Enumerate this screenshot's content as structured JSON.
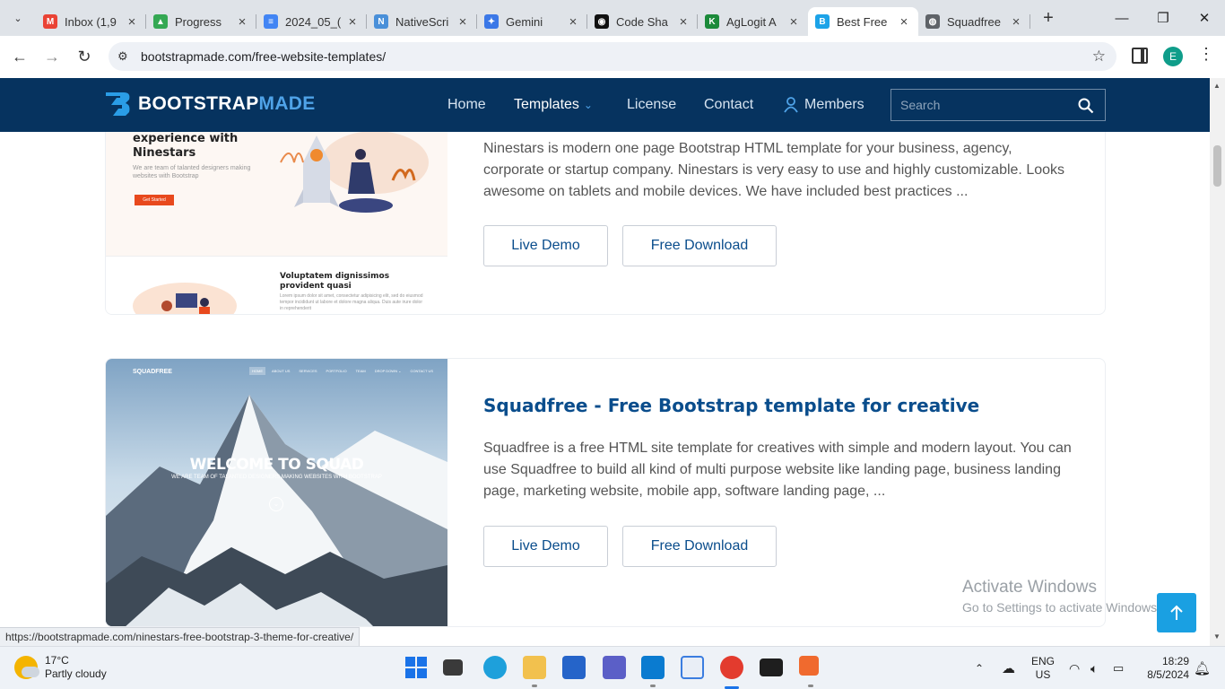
{
  "browser": {
    "tabs": [
      {
        "label": "Inbox (1,9",
        "icon": "gmail-icon",
        "color": "#ea4335",
        "glyph": "M"
      },
      {
        "label": "Progress",
        "icon": "google-drive-icon",
        "color": "#34a853",
        "glyph": "▲"
      },
      {
        "label": "2024_05_(",
        "icon": "google-docs-icon",
        "color": "#4285f4",
        "glyph": "≡"
      },
      {
        "label": "NativeScri",
        "icon": "notion-icon",
        "color": "#4a90d9",
        "glyph": "N"
      },
      {
        "label": "Gemini",
        "icon": "gemini-icon",
        "color": "#3b78e7",
        "glyph": "✦"
      },
      {
        "label": "Code Sha",
        "icon": "codeshare-icon",
        "color": "#111111",
        "glyph": "◉"
      },
      {
        "label": "AgLogit A",
        "icon": "aglogit-icon",
        "color": "#1b8a3a",
        "glyph": "K"
      },
      {
        "label": "Best Free",
        "icon": "bootstrapmade-icon",
        "color": "#1ca3e8",
        "glyph": "B"
      },
      {
        "label": "Squadfree",
        "icon": "globe-icon",
        "color": "#5f6368",
        "glyph": "◍"
      }
    ],
    "url": "bootstrapmade.com/free-website-templates/",
    "profile_initial": "E"
  },
  "site": {
    "brand_bold": "BOOTSTRAP",
    "brand_made": "MADE",
    "nav": {
      "home": "Home",
      "templates": "Templates",
      "license": "License",
      "contact": "Contact",
      "members": "Members"
    },
    "search_placeholder": "Search"
  },
  "templates": [
    {
      "desc": "Ninestars is modern one page Bootstrap HTML template for your business, agency, corporate or startup company. Ninestars is very easy to use and highly customizable. Looks awesome on tablets and mobile devices. We have included best practices ...",
      "live_demo": "Live Demo",
      "download": "Free Download",
      "preview": {
        "hero_title": "experience with Ninestars",
        "hero_sub": "We are team of talanted designers making websites with Bootstrap",
        "cta": "Get Started",
        "section_title": "Voluptatem dignissimos provident quasi",
        "section_text": "Lorem ipsum dolor sit amet, consectetur adipisicing elit, sed do eiusmod tempor incididunt ut labore et dolore magna aliqua. Duis aute irure dolor in reprehenderit"
      }
    },
    {
      "title": "Squadfree - Free Bootstrap template for creative",
      "desc": "Squadfree is a free HTML site template for creatives with simple and modern layout. You can use Squadfree to build all kind of multi purpose website like landing page, business landing page, marketing website, mobile app, software landing page, ...",
      "live_demo": "Live Demo",
      "download": "Free Download",
      "preview": {
        "logo": "SQUADFREE",
        "menu": [
          "HOME",
          "ABOUT US",
          "SERVICES",
          "PORTFOLIO",
          "TEAM",
          "DROP DOWN ⌄",
          "CONTACT US"
        ],
        "headline": "WELCOME TO SQUAD",
        "subline": "WE ARE TEAM OF TALANTED DESIGNERS MAKING WEBSITES WITH BOOTSTRAP"
      }
    }
  ],
  "status_url": "https://bootstrapmade.com/ninestars-free-bootstrap-3-theme-for-creative/",
  "watermark": {
    "line1": "Activate Windows",
    "line2": "Go to Settings to activate Windows."
  },
  "taskbar": {
    "temp": "17°C",
    "condition": "Partly cloudy",
    "lang1": "ENG",
    "lang2": "US",
    "time": "18:29",
    "date": "8/5/2024"
  }
}
